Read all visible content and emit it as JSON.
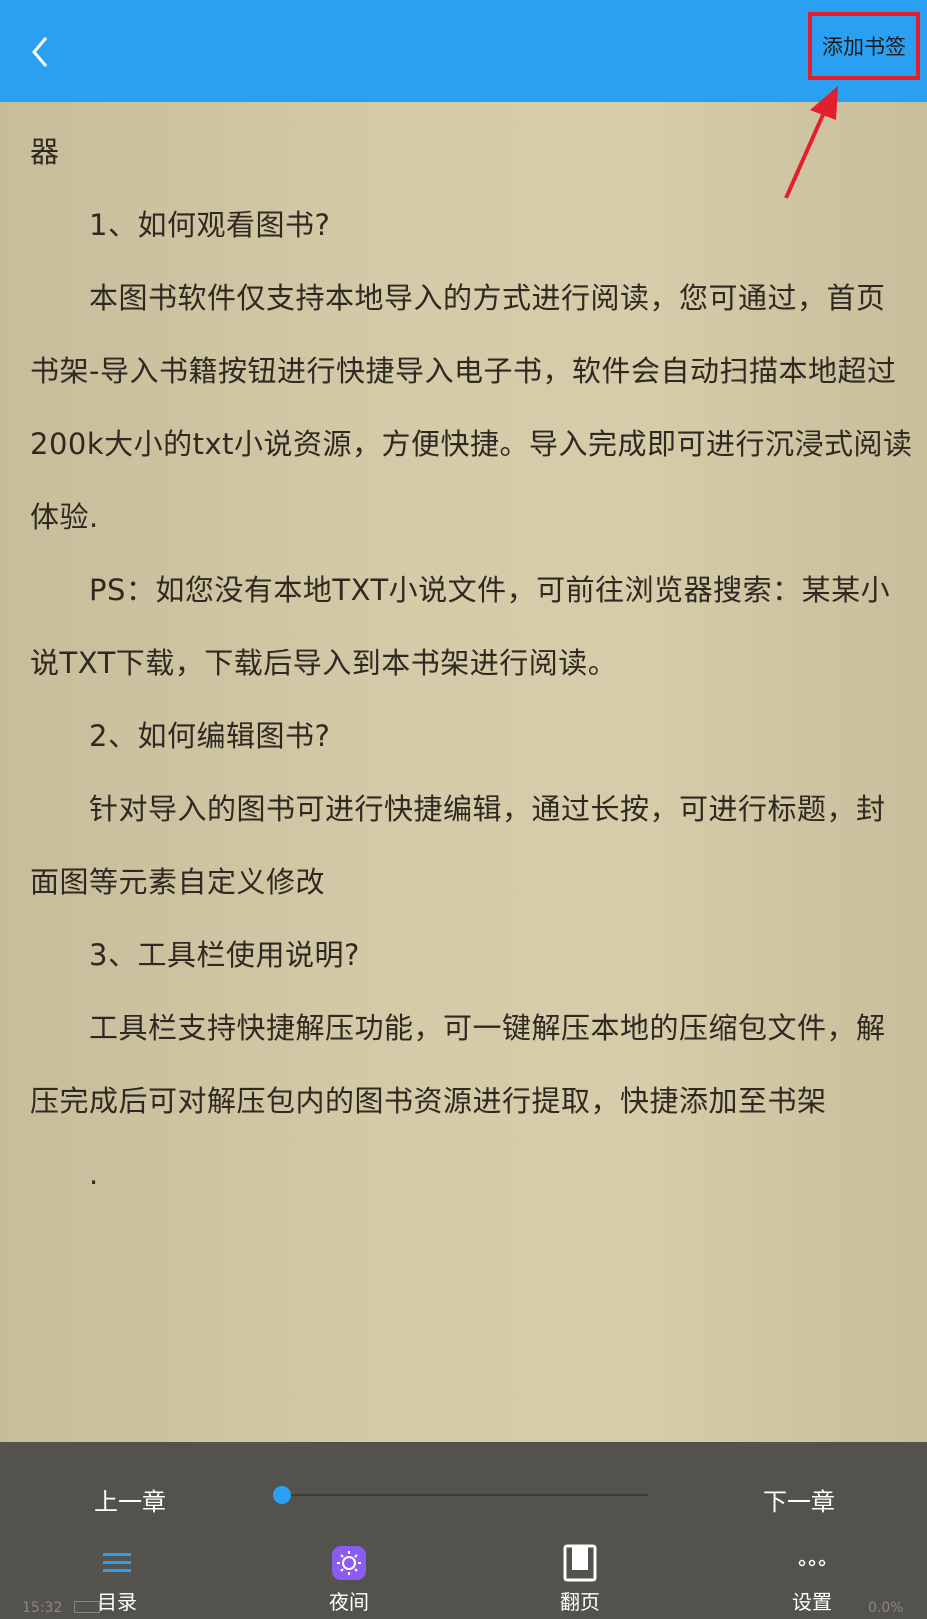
{
  "header": {
    "back_icon": "chevron-left-icon",
    "add_bookmark_label": "添加书签",
    "accent_color": "#2aa0f3",
    "highlight_color": "#e0202a"
  },
  "content": {
    "lines": [
      "器",
      "1、如何观看图书?",
      "本图书软件仅支持本地导入的方式进行阅读，您可通过，首页",
      "书架-导入书籍按钮进行快捷导入电子书，软件会自动扫描本地超过",
      "200k大小的txt小说资源，方便快捷。导入完成即可进行沉浸式阅读",
      "体验.",
      "PS：如您没有本地TXT小说文件，可前往浏览器搜索：某某小",
      "说TXT下载，下载后导入到本书架进行阅读。",
      "2、如何编辑图书?",
      "针对导入的图书可进行快捷编辑，通过长按，可进行标题，封",
      "面图等元素自定义修改",
      "3、工具栏使用说明?",
      "工具栏支持快捷解压功能，可一键解压本地的压缩包文件，解",
      "压完成后可对解压包内的图书资源进行提取，快捷添加至书架",
      "."
    ]
  },
  "controls": {
    "prev_chapter": "上一章",
    "next_chapter": "下一章",
    "progress": 0
  },
  "tabs": [
    {
      "label": "目录",
      "icon": "menu-list-icon"
    },
    {
      "label": "夜间",
      "icon": "night-mode-icon"
    },
    {
      "label": "翻页",
      "icon": "page-turn-icon"
    },
    {
      "label": "设置",
      "icon": "more-dots-icon"
    }
  ],
  "status": {
    "time": "15:32",
    "percent": "0.0%"
  }
}
